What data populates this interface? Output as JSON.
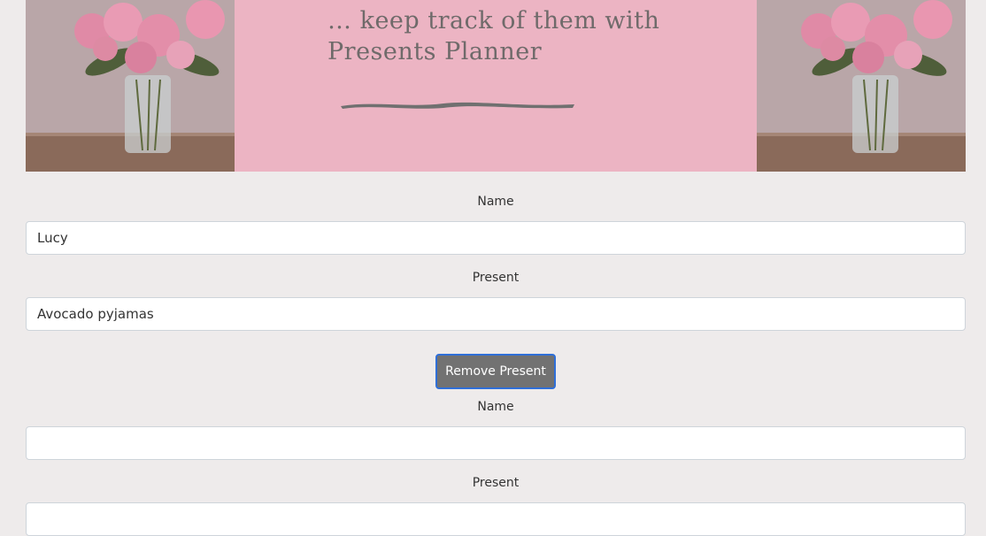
{
  "banner": {
    "tagline_line1": "… keep track of them with",
    "tagline_line2": "Presents Planner",
    "left_image_icon": "peony-vase-photo",
    "right_image_icon": "peony-vase-photo",
    "accent_color": "#ecb4c3"
  },
  "entries": [
    {
      "name_label": "Name",
      "name_value": "Lucy",
      "present_label": "Present",
      "present_value": "Avocado pyjamas",
      "remove_button_label": "Remove Present"
    },
    {
      "name_label": "Name",
      "name_value": "",
      "present_label": "Present",
      "present_value": ""
    }
  ],
  "colors": {
    "page_background": "#eeebeb",
    "button_background": "#727272",
    "button_border": "#2f6fd8"
  }
}
